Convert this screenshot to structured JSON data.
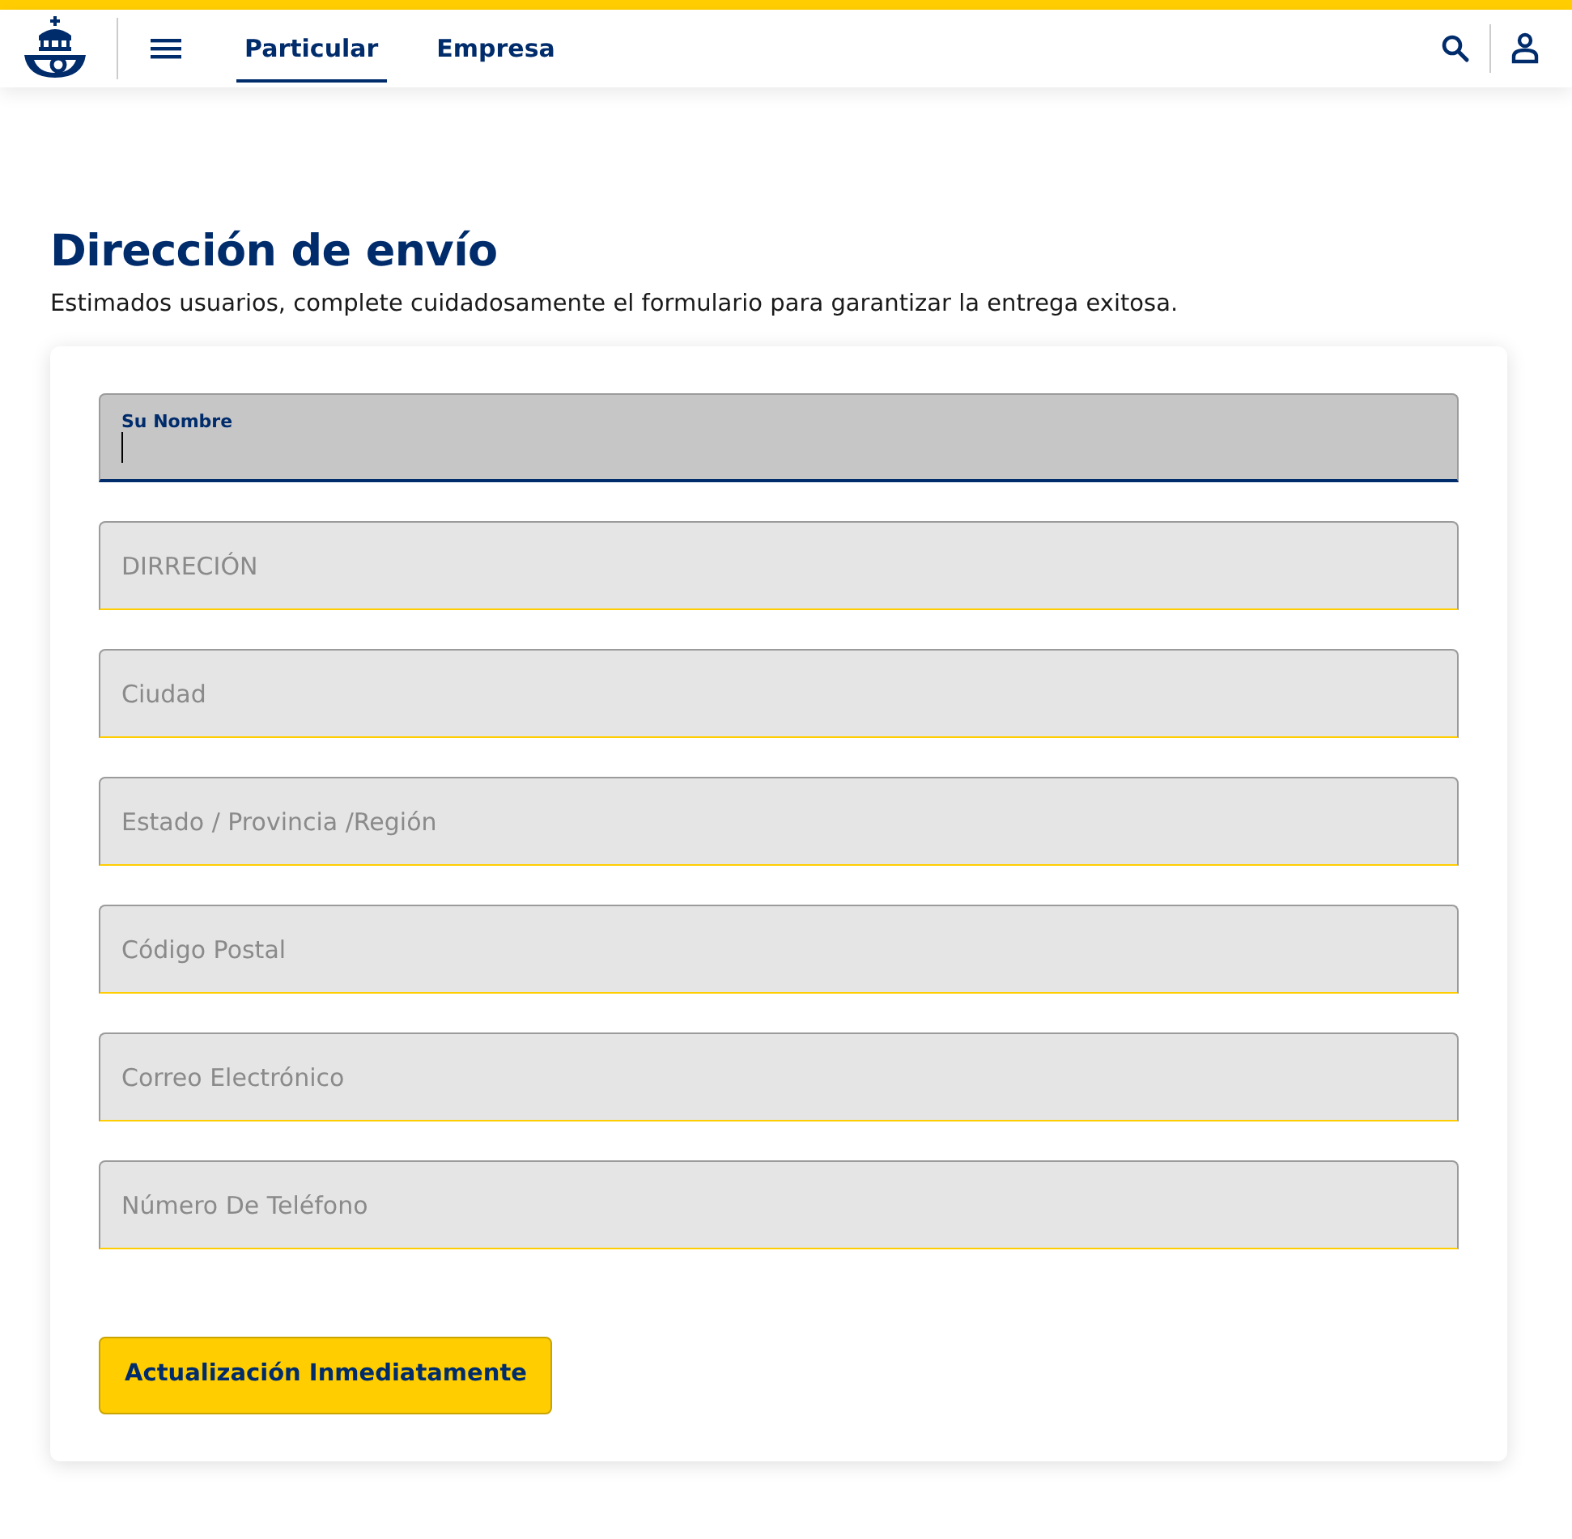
{
  "header": {
    "nav_tabs": [
      {
        "label": "Particular",
        "selected": true
      },
      {
        "label": "Empresa",
        "selected": false
      }
    ]
  },
  "form": {
    "title": "Dirección de envío",
    "subtitle": "Estimados usuarios, complete cuidadosamente el formulario para garantizar la entrega exitosa.",
    "fields": [
      {
        "placeholder": "Su Nombre",
        "focused": true
      },
      {
        "placeholder": "DIRRECIÓN",
        "focused": false
      },
      {
        "placeholder": "Ciudad",
        "focused": false
      },
      {
        "placeholder": "Estado / Provincia /Región",
        "focused": false
      },
      {
        "placeholder": "Código Postal",
        "focused": false
      },
      {
        "placeholder": "Correo Electrónico",
        "focused": false
      },
      {
        "placeholder": "Número De Teléfono",
        "focused": false
      }
    ],
    "submit": "Actualización Inmediatamente"
  }
}
